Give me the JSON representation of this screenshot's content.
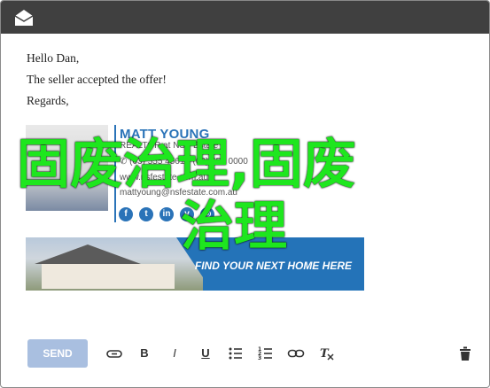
{
  "email": {
    "greeting": "Hello Dan,",
    "message": "The seller accepted the offer!",
    "closing": "Regards,"
  },
  "signature": {
    "name": "MATT YOUNG",
    "title": "REALTOR at NSF Estate",
    "phone": "✆ (03) 555 4561 • (03) 555 0000",
    "website": "www.nsfestate.com.au",
    "email": "mattyoung@nsfestate.com.au",
    "social_icons": [
      "facebook-icon",
      "twitter-icon",
      "linkedin-icon",
      "vine-icon",
      "instagram-icon"
    ],
    "accent_color": "#2a73b8"
  },
  "banner": {
    "cta": "FIND YOUR NEXT HOME HERE"
  },
  "watermark": {
    "line1": "固废治理,固废",
    "line2": "治理"
  },
  "toolbar": {
    "send_label": "SEND",
    "tools": [
      "attach-icon",
      "bold-icon",
      "italic-icon",
      "underline-icon",
      "bullet-list-icon",
      "numbered-list-icon",
      "link-icon",
      "clear-format-icon",
      "trash-icon"
    ]
  }
}
